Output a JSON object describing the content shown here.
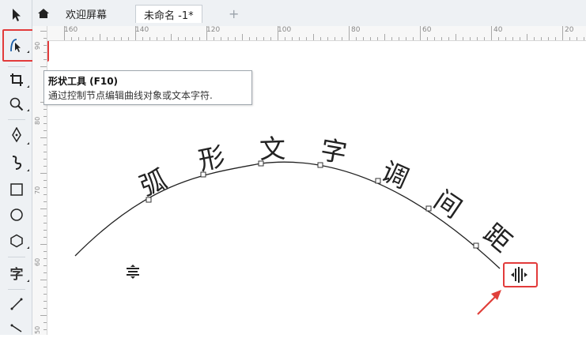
{
  "tabs": [
    {
      "label": "欢迎屏幕"
    },
    {
      "label": "未命名 -1*"
    }
  ],
  "new_tab_label": "+",
  "tooltip": {
    "title": "形状工具 (F10)",
    "description": "通过控制节点编辑曲线对象或文本字符."
  },
  "text_tool_label": "字",
  "ruler_top": [
    "160",
    "140",
    "120",
    "100",
    "80",
    "60",
    "40",
    "20"
  ],
  "ruler_left": [
    "90",
    "80",
    "70",
    "60",
    "50"
  ],
  "canvas": {
    "curve_text": [
      "弧",
      "形",
      "文",
      "字",
      "调",
      "间",
      "距"
    ]
  },
  "colors": {
    "highlight": "#e23b3b",
    "arrow": "#e0403a"
  },
  "icons": {
    "selected_tool": "shape-tool-icon",
    "spacing_handle_right": "letter-spacing-handle-icon",
    "spacing_handle_left": "line-spacing-handle-icon"
  }
}
